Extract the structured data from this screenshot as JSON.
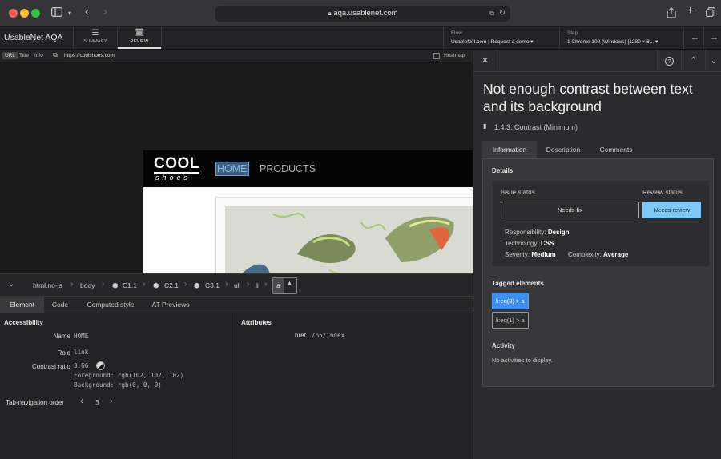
{
  "browser": {
    "url": "aqa.usablenet.com"
  },
  "app": {
    "brand": "UsableNet AQA",
    "tabs": [
      {
        "label": "SUMMARY"
      },
      {
        "label": "REVIEW"
      }
    ],
    "flow": {
      "label": "Flow",
      "value": "UsableNet.com | Request a demo ▾"
    },
    "step": {
      "label": "Step",
      "value": "1 Chrome 102 (Windows) [1280 × 8... ▾"
    }
  },
  "urlrow": {
    "url_badge": "URL",
    "title": "Title",
    "info": "Info",
    "link": "https://coolshoes.com",
    "heatmap": "Heatmap"
  },
  "site": {
    "logo_top": "COOL",
    "logo_bottom": "shoes",
    "nav_home": "HOME",
    "nav_products": "PRODUCTS"
  },
  "breadcrumbs": [
    "html.no-js",
    "body",
    "C1.1",
    "C2.1",
    "C3.1",
    "ul",
    "li",
    "a"
  ],
  "bottom_tabs": [
    "Element",
    "Code",
    "Computed style",
    "AT Previews"
  ],
  "accessibility": {
    "header": "Accessibility",
    "name_label": "Name",
    "name_value": "HOME",
    "role_label": "Role",
    "role_value": "link",
    "contrast_label": "Contrast ratio",
    "contrast_value": "3.66",
    "foreground": "Foreground: rgb(102, 102, 102)",
    "background": "Background: rgb(0, 0, 0)",
    "tab_order_label": "Tab-navigation order",
    "tab_order_value": "3"
  },
  "attributes": {
    "header": "Attributes",
    "key": "href",
    "value": "/h5/index"
  },
  "issue": {
    "title": "Not enough contrast between text and its background",
    "criterion": "1.4.3: Contrast (Minimum)",
    "tabs": [
      "Information",
      "Description",
      "Comments"
    ],
    "details_header": "Details",
    "issue_status_label": "Issue status",
    "issue_status_value": "Needs fix",
    "review_status_label": "Review status",
    "review_status_value": "Needs review",
    "responsibility_label": "Responsibility:",
    "responsibility_value": "Design",
    "technology_label": "Technology:",
    "technology_value": "CSS",
    "severity_label": "Severity:",
    "severity_value": "Medium",
    "complexity_label": "Complexity:",
    "complexity_value": "Average",
    "tagged_header": "Tagged elements",
    "tagged": [
      "li:eq(0) > a",
      "li:eq(1) > a"
    ],
    "activity_header": "Activity",
    "activity_empty": "No activities to display."
  },
  "colors": {
    "accent": "#7ec8f7",
    "selected_chip": "#3d8ef0"
  }
}
